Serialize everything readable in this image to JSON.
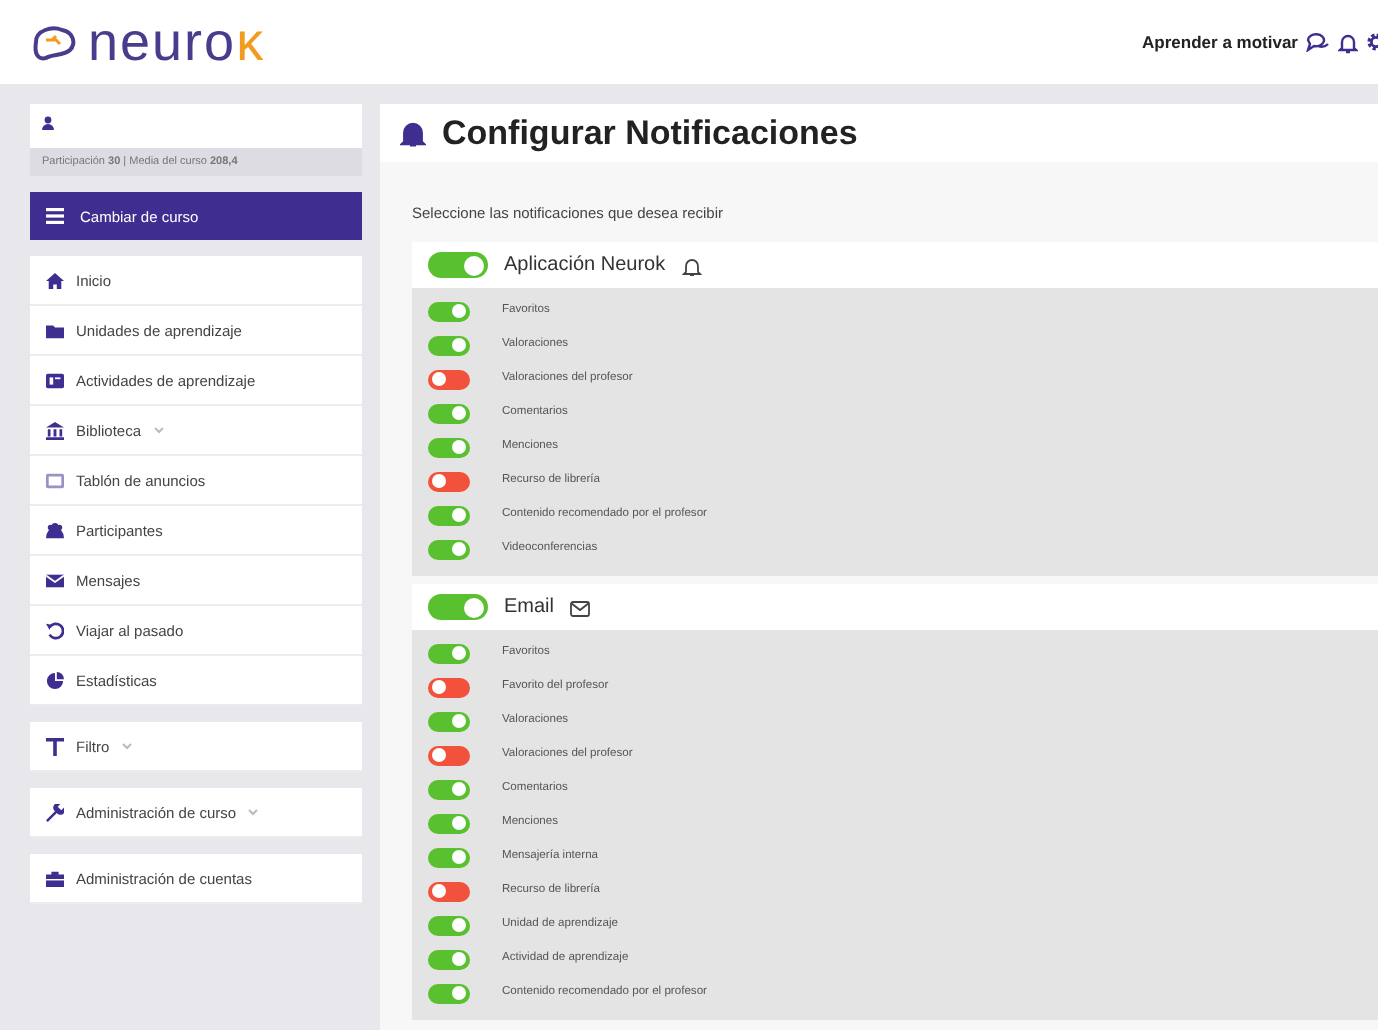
{
  "header": {
    "logo": {
      "text": "neuro",
      "accent": "κ"
    },
    "course": "Aprender a motivar"
  },
  "sidebar": {
    "stats": "Participación **30** | Media del curso **208,4**",
    "change_course": "Cambiar de curso",
    "menu": [
      {
        "label": "Inicio",
        "has_menu": false
      },
      {
        "label": "Unidades de aprendizaje",
        "has_menu": false
      },
      {
        "label": "Actividades de aprendizaje",
        "has_menu": false
      },
      {
        "label": "Biblioteca",
        "has_menu": true
      },
      {
        "label": "Tablón de anuncios",
        "has_menu": false
      },
      {
        "label": "Participantes",
        "has_menu": false
      },
      {
        "label": "Mensajes",
        "has_menu": false
      },
      {
        "label": "Viajar al pasado",
        "has_menu": false
      },
      {
        "label": "Estadísticas",
        "has_menu": false
      }
    ],
    "groups": [
      {
        "label": "Filtro",
        "has_menu": true
      },
      {
        "label": "Administración de curso",
        "has_menu": true
      },
      {
        "label": "Administración de cuentas",
        "has_menu": false
      }
    ]
  },
  "main": {
    "title": "Configurar Notificaciones",
    "intro": "Seleccione las notificaciones que desea recibir",
    "channels": [
      {
        "name": "Aplicación Neurok",
        "on": true,
        "items": [
          {
            "label": "Favoritos",
            "on": true
          },
          {
            "label": "Valoraciones",
            "on": true
          },
          {
            "label": "Valoraciones del profesor",
            "on": false
          },
          {
            "label": "Comentarios",
            "on": true
          },
          {
            "label": "Menciones",
            "on": true
          },
          {
            "label": "Recurso de librería",
            "on": false
          },
          {
            "label": "Contenido recomendado por el profesor",
            "on": true
          },
          {
            "label": "Videoconferencias",
            "on": true
          }
        ]
      },
      {
        "name": "Email",
        "on": true,
        "items": [
          {
            "label": "Favoritos",
            "on": true
          },
          {
            "label": "Favorito del profesor",
            "on": false
          },
          {
            "label": "Valoraciones",
            "on": true
          },
          {
            "label": "Valoraciones del profesor",
            "on": false
          },
          {
            "label": "Comentarios",
            "on": true
          },
          {
            "label": "Menciones",
            "on": true
          },
          {
            "label": "Mensajería interna",
            "on": true
          },
          {
            "label": "Recurso de librería",
            "on": false
          },
          {
            "label": "Unidad de aprendizaje",
            "on": true
          },
          {
            "label": "Actividad de aprendizaje",
            "on": true
          },
          {
            "label": "Contenido recomendado por el profesor",
            "on": true
          }
        ]
      }
    ]
  }
}
